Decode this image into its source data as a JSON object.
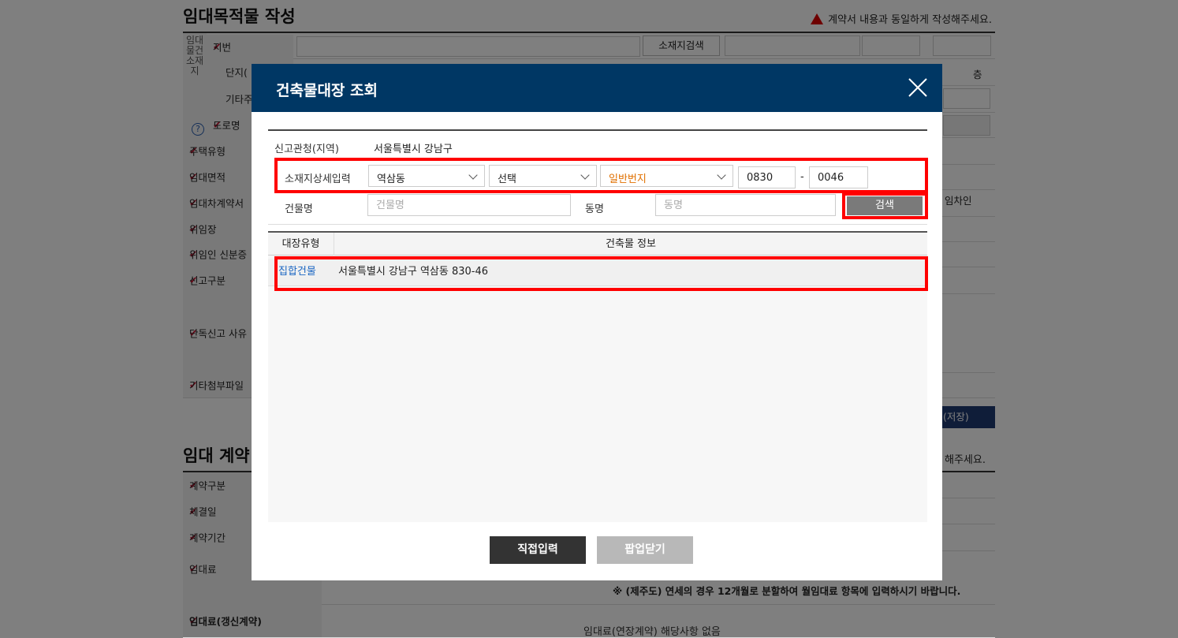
{
  "background": {
    "section1_title": "임대목적물 작성",
    "section1_notice": "계약서 내용과 동일하게 작성해주세요.",
    "location_side_label": "임대물건소재지",
    "rows": {
      "jibun": "지번",
      "danji": "단지(",
      "gita": "기타주",
      "doro": "도로명",
      "jutaek": "주택유형",
      "area": "임대면적",
      "lessee_contract": "임대차계약서",
      "power_of_attorney": "위임장",
      "delegate_id": "위임인 신분증",
      "report_type": "신고구분",
      "single_report": "단독신고 사유",
      "other_attachments": "기타첨부파일"
    },
    "location_search_button": "소재지검색",
    "floor_unit": "층",
    "lessee_fragment": "임차인",
    "save_button_fragment": "(저장)",
    "section2_title": "임대 계약",
    "section2_notice_fragment": "해주세요.",
    "rows2": {
      "contract_type": "계약구분",
      "conclusion_date": "체결일",
      "period": "계약기간",
      "rent": "임대료",
      "rent_renewal": "임대료(갱신계약)"
    },
    "jeju_note": "※ (제주도) 연세의 경우 12개월로 분할하여 월임대료 항목에 입력하시기 바랍니다.",
    "renewal_value": "임대료(연장계약) 해당사항 없음"
  },
  "modal": {
    "title": "건축물대장 조회",
    "office_label": "신고관청(지역)",
    "office_value": "서울특별시 강남구",
    "detail_label": "소재지상세입력",
    "dong_select": "역삼동",
    "ri_select": "선택",
    "bunji_select": "일반번지",
    "bun_value": "0830",
    "ji_value": "0046",
    "building_name_label": "건물명",
    "building_name_placeholder": "건물명",
    "dong_name_label": "동명",
    "dong_name_placeholder": "동명",
    "search_button": "검색",
    "table_headers": [
      "대장유형",
      "건축물 정보"
    ],
    "results": [
      {
        "type": "집합건물",
        "info": "서울특별시 강남구 역삼동 830-46"
      }
    ],
    "direct_input_button": "직접입력",
    "close_button": "팝업닫기"
  },
  "colors": {
    "modal_header": "#003764",
    "highlight": "#ff0000",
    "link_blue": "#1a66c2",
    "orange": "#e07000"
  }
}
